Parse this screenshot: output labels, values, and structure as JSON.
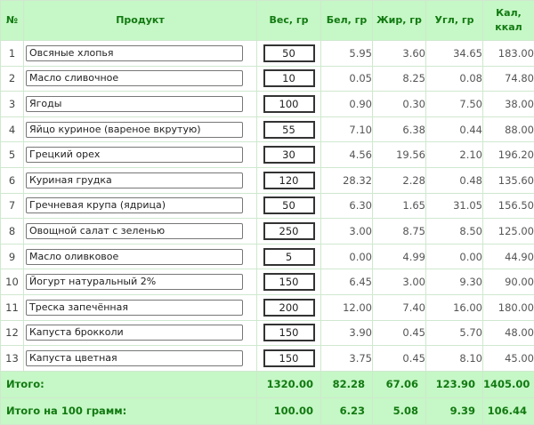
{
  "headers": {
    "num": "№",
    "product": "Продукт",
    "weight": "Вес, гр",
    "protein": "Бел, гр",
    "fat": "Жир, гр",
    "carb": "Угл, гр",
    "kcal_line1": "Кал,",
    "kcal_line2": "ккал"
  },
  "rows": [
    {
      "num": "1",
      "product": "Овсяные хлопья",
      "weight": "50",
      "protein": "5.95",
      "fat": "3.60",
      "carb": "34.65",
      "kcal": "183.00"
    },
    {
      "num": "2",
      "product": "Масло сливочное",
      "weight": "10",
      "protein": "0.05",
      "fat": "8.25",
      "carb": "0.08",
      "kcal": "74.80"
    },
    {
      "num": "3",
      "product": "Ягоды",
      "weight": "100",
      "protein": "0.90",
      "fat": "0.30",
      "carb": "7.50",
      "kcal": "38.00"
    },
    {
      "num": "4",
      "product": "Яйцо куриное (вареное вкрутую)",
      "weight": "55",
      "protein": "7.10",
      "fat": "6.38",
      "carb": "0.44",
      "kcal": "88.00"
    },
    {
      "num": "5",
      "product": "Грецкий орех",
      "weight": "30",
      "protein": "4.56",
      "fat": "19.56",
      "carb": "2.10",
      "kcal": "196.20"
    },
    {
      "num": "6",
      "product": "Куриная грудка",
      "weight": "120",
      "protein": "28.32",
      "fat": "2.28",
      "carb": "0.48",
      "kcal": "135.60"
    },
    {
      "num": "7",
      "product": "Гречневая крупа (ядрица)",
      "weight": "50",
      "protein": "6.30",
      "fat": "1.65",
      "carb": "31.05",
      "kcal": "156.50"
    },
    {
      "num": "8",
      "product": "Овощной салат с зеленью",
      "weight": "250",
      "protein": "3.00",
      "fat": "8.75",
      "carb": "8.50",
      "kcal": "125.00"
    },
    {
      "num": "9",
      "product": "Масло оливковое",
      "weight": "5",
      "protein": "0.00",
      "fat": "4.99",
      "carb": "0.00",
      "kcal": "44.90"
    },
    {
      "num": "10",
      "product": "Йогурт натуральный 2%",
      "weight": "150",
      "protein": "6.45",
      "fat": "3.00",
      "carb": "9.30",
      "kcal": "90.00"
    },
    {
      "num": "11",
      "product": "Треска запечённая",
      "weight": "200",
      "protein": "12.00",
      "fat": "7.40",
      "carb": "16.00",
      "kcal": "180.00"
    },
    {
      "num": "12",
      "product": "Капуста брокколи",
      "weight": "150",
      "protein": "3.90",
      "fat": "0.45",
      "carb": "5.70",
      "kcal": "48.00"
    },
    {
      "num": "13",
      "product": "Капуста цветная",
      "weight": "150",
      "protein": "3.75",
      "fat": "0.45",
      "carb": "8.10",
      "kcal": "45.00"
    }
  ],
  "totals": {
    "label": "Итого:",
    "weight": "1320.00",
    "protein": "82.28",
    "fat": "67.06",
    "carb": "123.90",
    "kcal": "1405.00"
  },
  "per100": {
    "label": "Итого на 100 грамм:",
    "weight": "100.00",
    "protein": "6.23",
    "fat": "5.08",
    "carb": "9.39",
    "kcal": "106.44"
  }
}
